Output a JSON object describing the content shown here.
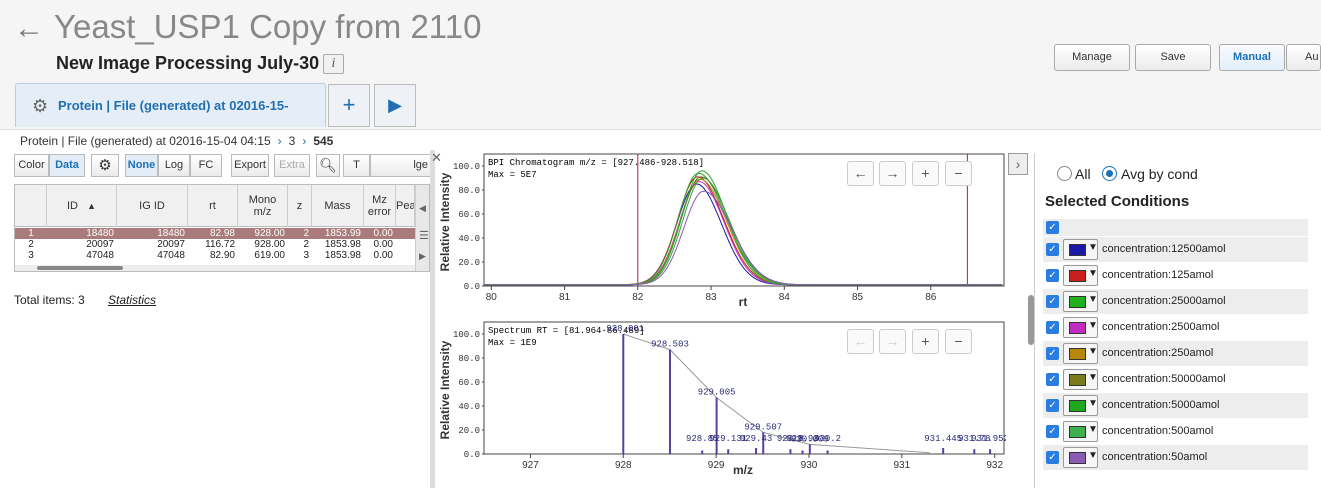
{
  "header": {
    "title": "Yeast_USP1 Copy from 2110",
    "subtitle": "New Image Processing July-30",
    "info_label": "i",
    "buttons": {
      "manage": "Manage",
      "save": "Save",
      "manual": "Manual",
      "auto": "Au"
    }
  },
  "tab": {
    "label": "Protein | File (generated) at 02016-15-",
    "add_label": "+",
    "run_label": "▶"
  },
  "breadcrumb": {
    "file": "Protein | File (generated) at 02016-15-04 04:15",
    "level": "3",
    "item": "545"
  },
  "table_toolbar": {
    "color": "Color",
    "data": "Data",
    "none": "None",
    "log": "Log",
    "fc": "FC",
    "export": "Export",
    "extra": "Extra",
    "t": "T",
    "overflow": "lge"
  },
  "grid": {
    "columns": [
      {
        "label": "ID",
        "sort": "▲"
      },
      {
        "label": "IG ID"
      },
      {
        "label": "rt"
      },
      {
        "label": "Mono\nm/z"
      },
      {
        "label": "z"
      },
      {
        "label": "Mass"
      },
      {
        "label": "Mz\nerror"
      },
      {
        "label": "Pea"
      }
    ],
    "rows": [
      {
        "n": "1",
        "id": "18480",
        "igid": "18480",
        "rt": "82.98",
        "mz": "928.00",
        "z": "2",
        "mass": "1853.99",
        "err": "0.00"
      },
      {
        "n": "2",
        "id": "20097",
        "igid": "20097",
        "rt": "116.72",
        "mz": "928.00",
        "z": "2",
        "mass": "1853.98",
        "err": "0.00"
      },
      {
        "n": "3",
        "id": "47048",
        "igid": "47048",
        "rt": "82.90",
        "mz": "619.00",
        "z": "3",
        "mass": "1853.98",
        "err": "0.00"
      }
    ],
    "selected_row": 0
  },
  "footer": {
    "total": "Total items: 3",
    "statistics": "Statistics"
  },
  "chart_data": [
    {
      "type": "line",
      "title": "BPI Chromatogram m/z = [927.486-928.518]",
      "subtitle": "Max = 5E7",
      "xlabel": "rt",
      "ylabel": "Relative Intensity",
      "xlim": [
        79.9,
        87.0
      ],
      "ylim": [
        0,
        110
      ],
      "x_ticks": [
        "80",
        "81",
        "82",
        "83",
        "84",
        "85",
        "86"
      ],
      "y_ticks": [
        "100.0",
        "80.0",
        "60.0",
        "40.0",
        "20.0",
        "0.0"
      ],
      "markers_x": [
        82.0,
        86.5
      ],
      "peak_center": 82.85,
      "series": [
        {
          "color": "#1a1a9e",
          "peak": 84
        },
        {
          "color": "#c81e1e",
          "peak": 90
        },
        {
          "color": "#2ea02e",
          "peak": 93
        },
        {
          "color": "#c22cc2",
          "peak": 86
        },
        {
          "color": "#b8860b",
          "peak": 88
        },
        {
          "color": "#6b6b1e",
          "peak": 90
        },
        {
          "color": "#27a827",
          "peak": 95
        },
        {
          "color": "#3aa04a",
          "peak": 89
        },
        {
          "color": "#8a5bb5",
          "peak": 78
        }
      ],
      "nav": [
        "←",
        "→",
        "+",
        "−"
      ]
    },
    {
      "type": "bar",
      "title": "Spectrum RT = [81.964-86.489]",
      "subtitle": "Max = 1E9",
      "xlabel": "m/z",
      "ylabel": "Relative Intensity",
      "xlim": [
        926.5,
        932.1
      ],
      "ylim": [
        0,
        110
      ],
      "x_ticks": [
        "927",
        "928",
        "929",
        "930",
        "931",
        "932"
      ],
      "y_ticks": [
        "100.0",
        "80.0",
        "60.0",
        "40.0",
        "20.0",
        "0.0"
      ],
      "peaks": [
        {
          "x": 928.0,
          "y": 100,
          "label": "928.001"
        },
        {
          "x": 928.503,
          "y": 87,
          "label": "928.503"
        },
        {
          "x": 929.005,
          "y": 47,
          "label": "929.005"
        },
        {
          "x": 929.507,
          "y": 18,
          "label": "929.507"
        },
        {
          "x": 930.009,
          "y": 8,
          "label": "930.009"
        },
        {
          "x": 928.85,
          "y": 3,
          "label": "928.85"
        },
        {
          "x": 929.13,
          "y": 4,
          "label": "929.131"
        },
        {
          "x": 929.43,
          "y": 5,
          "label": "929.43"
        },
        {
          "x": 929.8,
          "y": 4,
          "label": "929.8"
        },
        {
          "x": 929.93,
          "y": 3,
          "label": "929.93"
        },
        {
          "x": 930.2,
          "y": 3,
          "label": "930.2"
        },
        {
          "x": 931.445,
          "y": 5,
          "label": "931.445"
        },
        {
          "x": 931.78,
          "y": 4,
          "label": "931.78"
        },
        {
          "x": 931.95,
          "y": 4,
          "label": "931.952"
        }
      ],
      "nav": [
        "←",
        "→",
        "+",
        "−"
      ]
    }
  ],
  "right_panel": {
    "radio_all": "All",
    "radio_avg": "Avg by cond",
    "heading": "Selected Conditions",
    "conditions": [
      {
        "label": "concentration:12500amol",
        "color": "#1a1aa6"
      },
      {
        "label": "concentration:125amol",
        "color": "#c81e1e"
      },
      {
        "label": "concentration:25000amol",
        "color": "#20b020"
      },
      {
        "label": "concentration:2500amol",
        "color": "#c22cc2"
      },
      {
        "label": "concentration:250amol",
        "color": "#b8860b"
      },
      {
        "label": "concentration:50000amol",
        "color": "#7a7a1e"
      },
      {
        "label": "concentration:5000amol",
        "color": "#1fa81f"
      },
      {
        "label": "concentration:500amol",
        "color": "#3cb04c"
      },
      {
        "label": "concentration:50amol",
        "color": "#8a5bb5"
      }
    ]
  }
}
